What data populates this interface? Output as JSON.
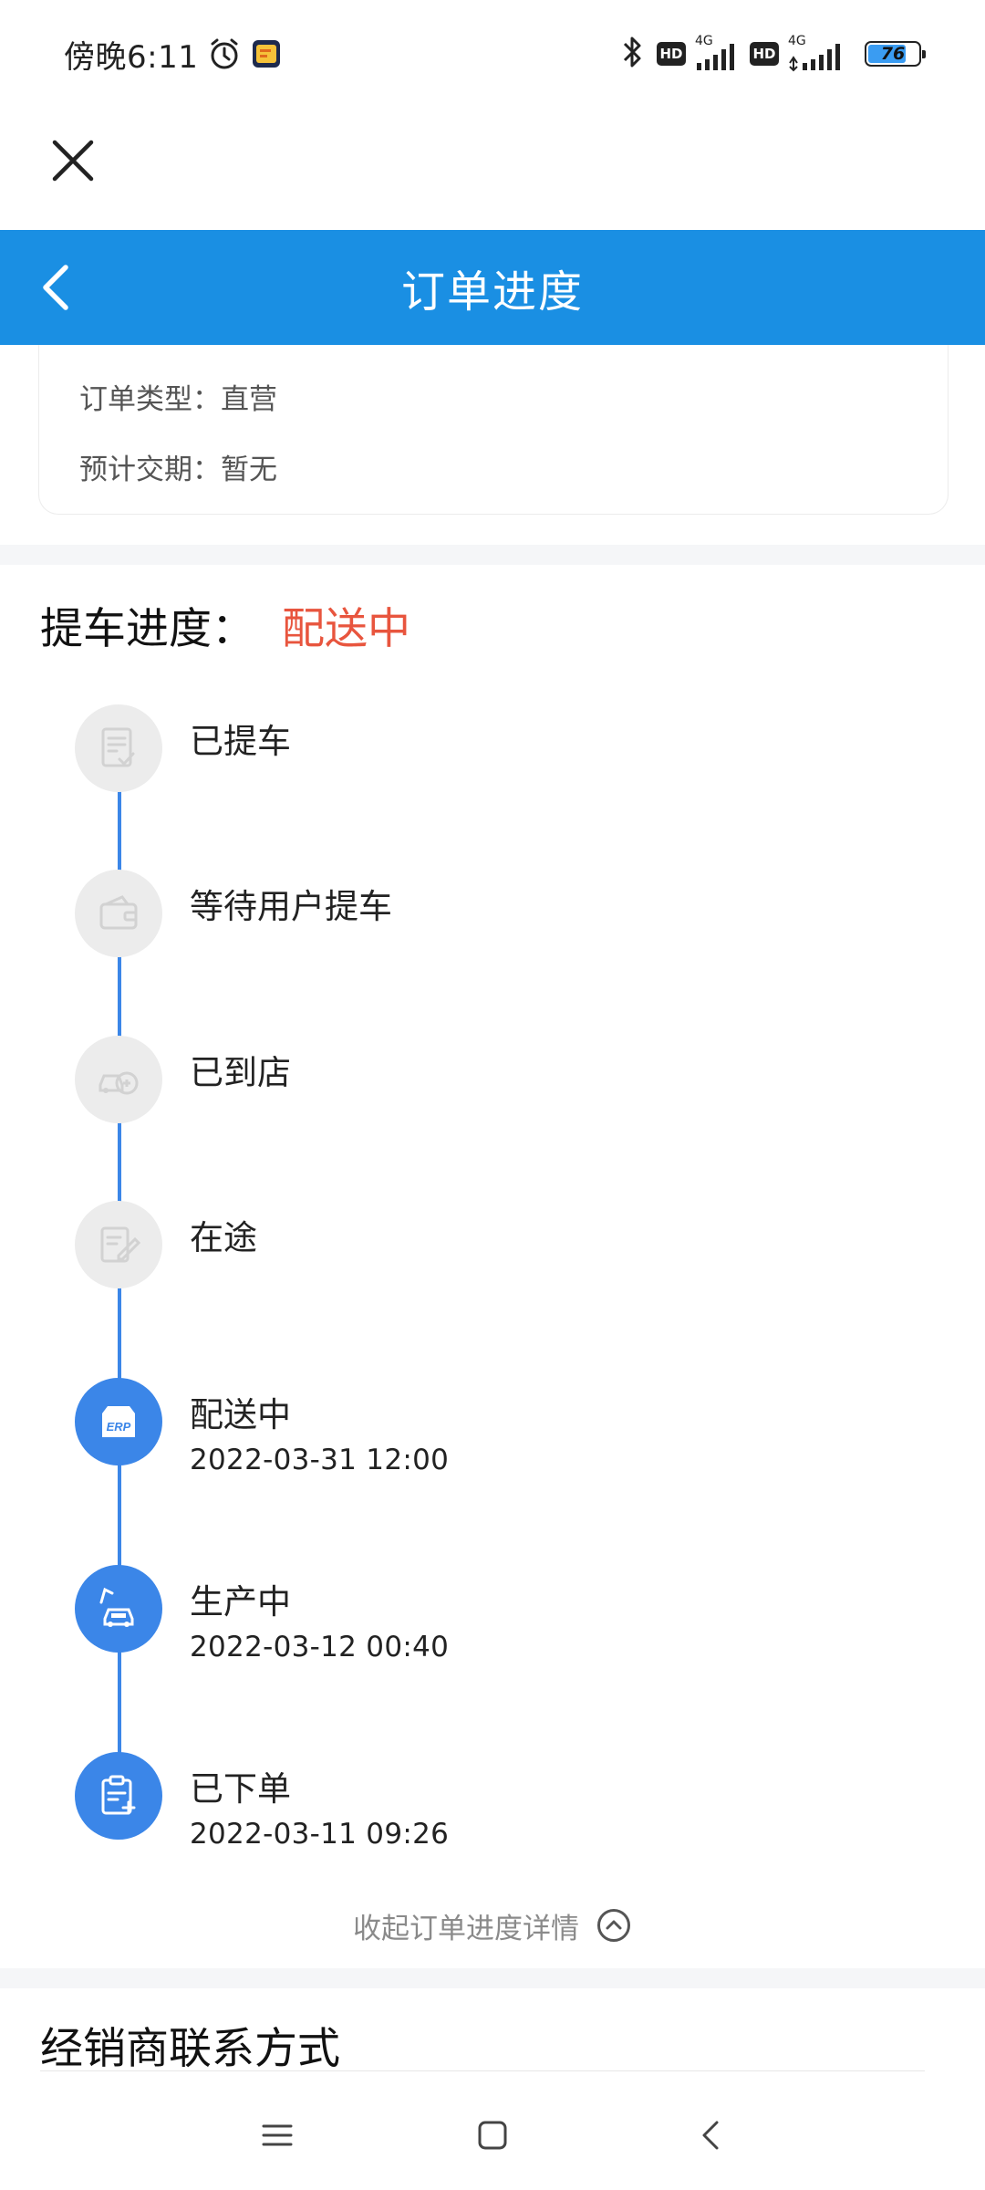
{
  "status_bar": {
    "time": "傍晚6:11",
    "hd1": "HD",
    "net1": "4G",
    "hd2": "HD",
    "net2": "4G",
    "battery": "76",
    "battery_level": 0.76,
    "battery_color": "#3a9cf2"
  },
  "header": {
    "title": "订单进度",
    "background": "#1a8fe3"
  },
  "order_info": {
    "type_row": "订单类型：直营",
    "delivery_row": "预计交期：暂无"
  },
  "progress": {
    "label": "提车进度：",
    "current_status": "配送中",
    "status_color": "#e8553e",
    "active_color": "#3b86e8",
    "steps": [
      {
        "title": "已提车",
        "time": "",
        "state": "inactive",
        "icon": "document-check-icon"
      },
      {
        "title": "等待用户提车",
        "time": "",
        "state": "inactive",
        "icon": "wallet-icon"
      },
      {
        "title": "已到店",
        "time": "",
        "state": "inactive",
        "icon": "car-store-icon"
      },
      {
        "title": "在途",
        "time": "",
        "state": "inactive",
        "icon": "edit-document-icon"
      },
      {
        "title": "配送中",
        "time": "2022-03-31 12:00",
        "state": "active",
        "icon": "erp-box-icon"
      },
      {
        "title": "生产中",
        "time": "2022-03-12 00:40",
        "state": "active",
        "icon": "car-crane-icon"
      },
      {
        "title": "已下单",
        "time": "2022-03-11 09:26",
        "state": "active",
        "icon": "clipboard-add-icon"
      }
    ],
    "collapse_label": "收起订单进度详情"
  },
  "dealer": {
    "heading": "经销商联系方式"
  }
}
